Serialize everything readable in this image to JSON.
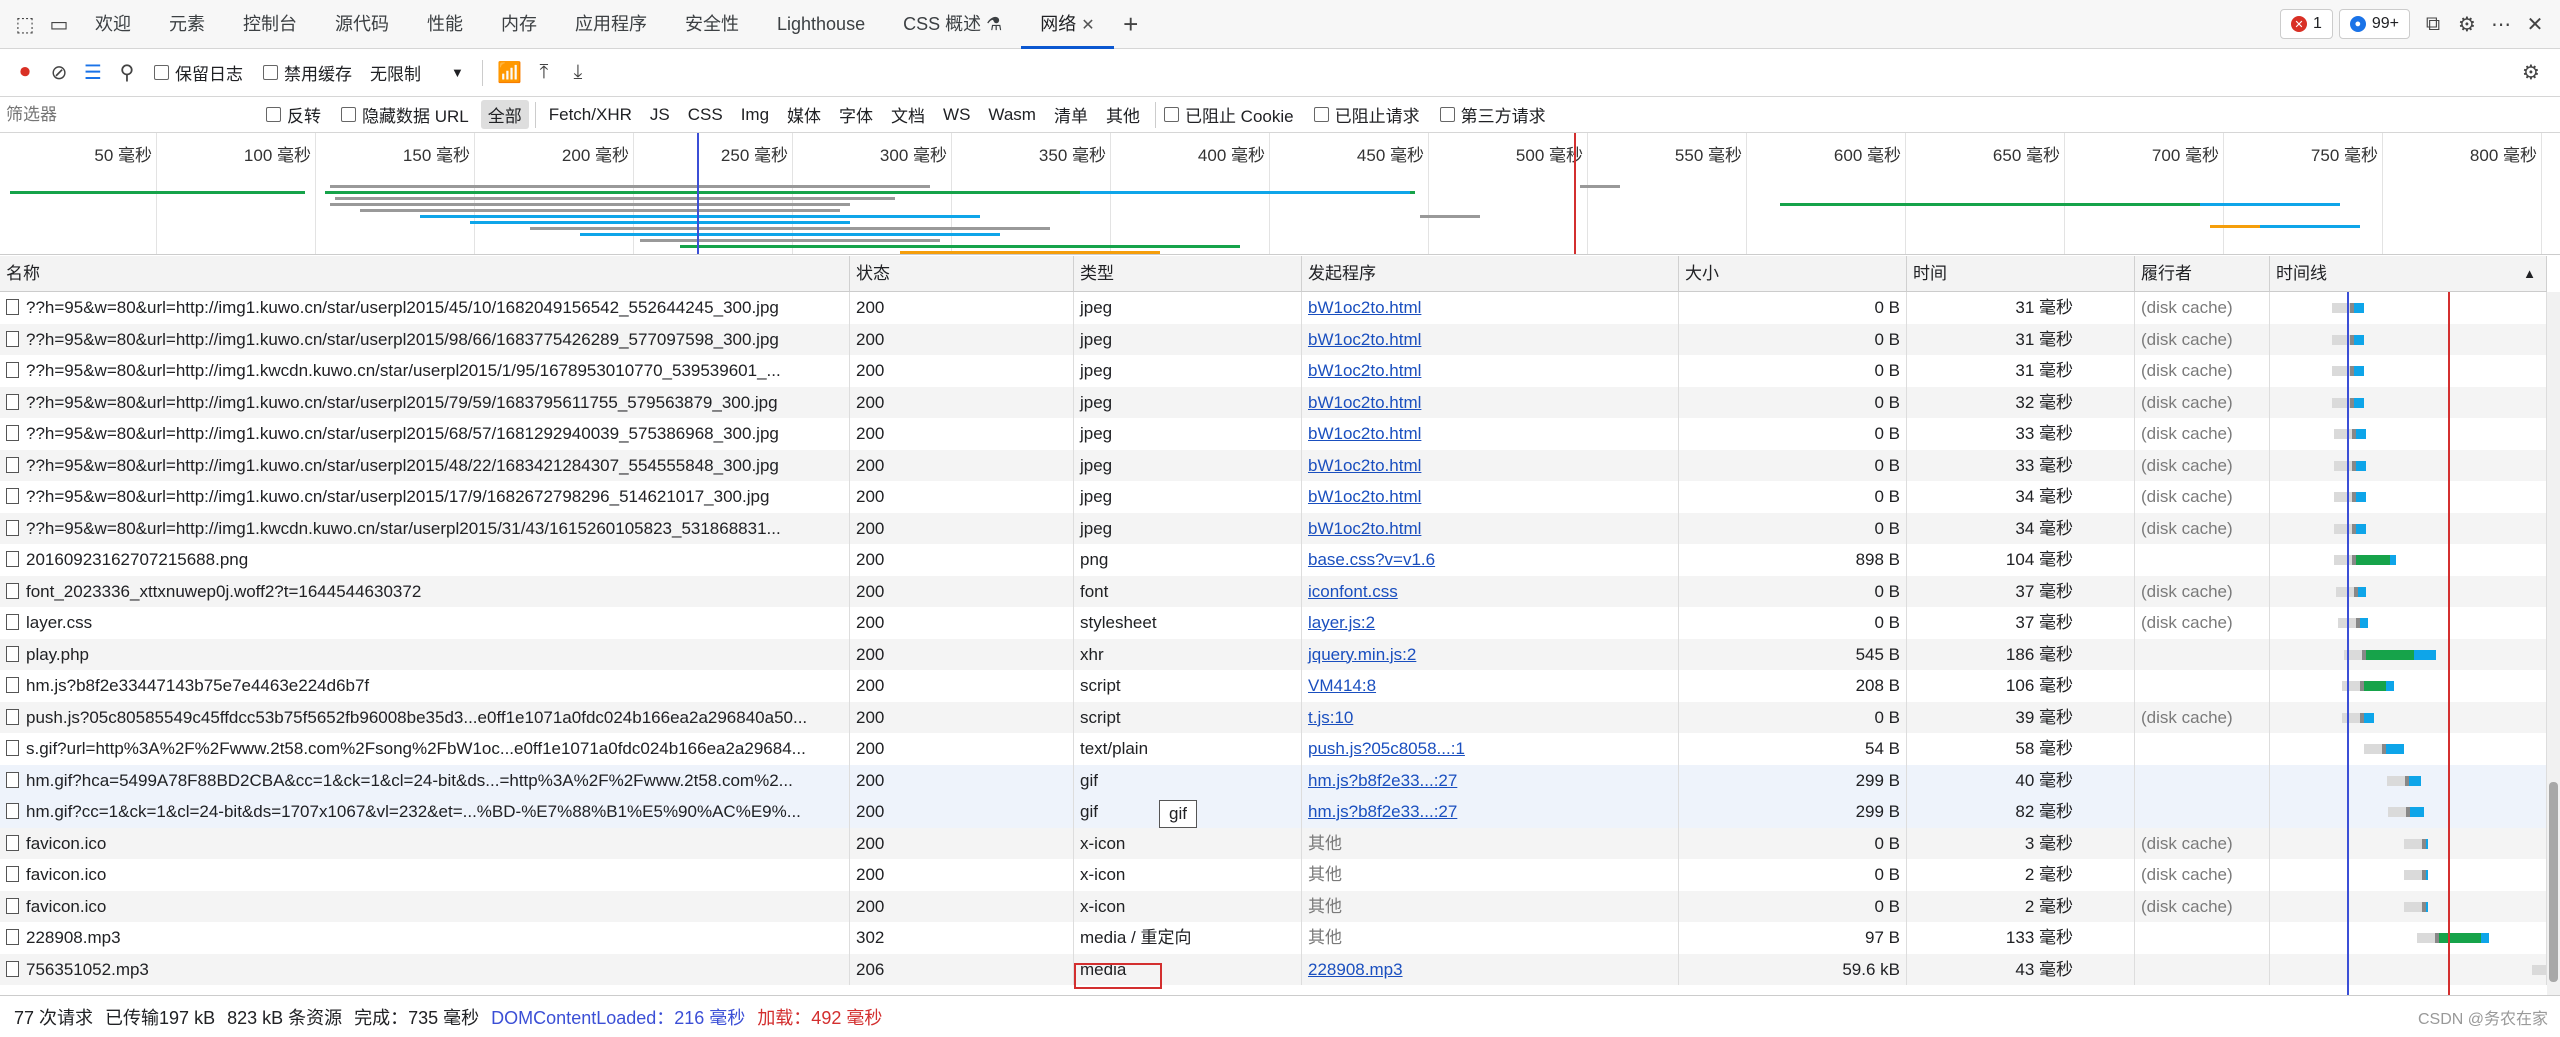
{
  "tabs": [
    {
      "label": "欢迎"
    },
    {
      "label": "元素"
    },
    {
      "label": "控制台"
    },
    {
      "label": "源代码"
    },
    {
      "label": "性能"
    },
    {
      "label": "内存"
    },
    {
      "label": "应用程序"
    },
    {
      "label": "安全性"
    },
    {
      "label": "Lighthouse"
    },
    {
      "label": "CSS 概述"
    },
    {
      "label": "网络"
    }
  ],
  "badges": {
    "errors": "1",
    "messages": "99+"
  },
  "toolbar": {
    "preserve_log": "保留日志",
    "disable_cache": "禁用缓存",
    "throttle": "无限制"
  },
  "filter": {
    "placeholder": "筛选器",
    "invert": "反转",
    "hide_data_url": "隐藏数据 URL",
    "types": [
      "全部",
      "Fetch/XHR",
      "JS",
      "CSS",
      "Img",
      "媒体",
      "字体",
      "文档",
      "WS",
      "Wasm",
      "清单",
      "其他"
    ],
    "blocked_cookie": "已阻止 Cookie",
    "blocked_requests": "已阻止请求",
    "third_party": "第三方请求"
  },
  "overview": {
    "ticks": [
      "50 毫秒",
      "100 毫秒",
      "150 毫秒",
      "200 毫秒",
      "250 毫秒",
      "300 毫秒",
      "350 毫秒",
      "400 毫秒",
      "450 毫秒",
      "500 毫秒",
      "550 毫秒",
      "600 毫秒",
      "650 毫秒",
      "700 毫秒",
      "750 毫秒",
      "800 毫秒"
    ]
  },
  "columns": {
    "name": "名称",
    "status": "状态",
    "type": "类型",
    "initiator": "发起程序",
    "size": "大小",
    "time": "时间",
    "fulfilled": "履行者",
    "waterfall": "时间线"
  },
  "rows": [
    {
      "name": "??h=95&w=80&url=http://img1.kuwo.cn/star/userpl2015/45/10/1682049156542_552644245_300.jpg",
      "status": "200",
      "type": "jpeg",
      "initiator": "bW1oc2to.html",
      "link": true,
      "size": "0 B",
      "time": "31 毫秒",
      "ful": "(disk cache)"
    },
    {
      "name": "??h=95&w=80&url=http://img1.kuwo.cn/star/userpl2015/98/66/1683775426289_577097598_300.jpg",
      "status": "200",
      "type": "jpeg",
      "initiator": "bW1oc2to.html",
      "link": true,
      "size": "0 B",
      "time": "31 毫秒",
      "ful": "(disk cache)"
    },
    {
      "name": "??h=95&w=80&url=http://img1.kwcdn.kuwo.cn/star/userpl2015/1/95/1678953010770_539539601_...",
      "status": "200",
      "type": "jpeg",
      "initiator": "bW1oc2to.html",
      "link": true,
      "size": "0 B",
      "time": "31 毫秒",
      "ful": "(disk cache)"
    },
    {
      "name": "??h=95&w=80&url=http://img1.kuwo.cn/star/userpl2015/79/59/1683795611755_579563879_300.jpg",
      "status": "200",
      "type": "jpeg",
      "initiator": "bW1oc2to.html",
      "link": true,
      "size": "0 B",
      "time": "32 毫秒",
      "ful": "(disk cache)"
    },
    {
      "name": "??h=95&w=80&url=http://img1.kuwo.cn/star/userpl2015/68/57/1681292940039_575386968_300.jpg",
      "status": "200",
      "type": "jpeg",
      "initiator": "bW1oc2to.html",
      "link": true,
      "size": "0 B",
      "time": "33 毫秒",
      "ful": "(disk cache)"
    },
    {
      "name": "??h=95&w=80&url=http://img1.kuwo.cn/star/userpl2015/48/22/1683421284307_554555848_300.jpg",
      "status": "200",
      "type": "jpeg",
      "initiator": "bW1oc2to.html",
      "link": true,
      "size": "0 B",
      "time": "33 毫秒",
      "ful": "(disk cache)"
    },
    {
      "name": "??h=95&w=80&url=http://img1.kuwo.cn/star/userpl2015/17/9/1682672798296_514621017_300.jpg",
      "status": "200",
      "type": "jpeg",
      "initiator": "bW1oc2to.html",
      "link": true,
      "size": "0 B",
      "time": "34 毫秒",
      "ful": "(disk cache)"
    },
    {
      "name": "??h=95&w=80&url=http://img1.kwcdn.kuwo.cn/star/userpl2015/31/43/1615260105823_531868831...",
      "status": "200",
      "type": "jpeg",
      "initiator": "bW1oc2to.html",
      "link": true,
      "size": "0 B",
      "time": "34 毫秒",
      "ful": "(disk cache)"
    },
    {
      "name": "20160923162707215688.png",
      "status": "200",
      "type": "png",
      "initiator": "base.css?v=v1.6",
      "link": true,
      "size": "898 B",
      "time": "104 毫秒",
      "ful": ""
    },
    {
      "name": "font_2023336_xttxnuwep0j.woff2?t=1644544630372",
      "status": "200",
      "type": "font",
      "initiator": "iconfont.css",
      "link": true,
      "size": "0 B",
      "time": "37 毫秒",
      "ful": "(disk cache)"
    },
    {
      "name": "layer.css",
      "status": "200",
      "type": "stylesheet",
      "initiator": "layer.js:2",
      "link": true,
      "size": "0 B",
      "time": "37 毫秒",
      "ful": "(disk cache)"
    },
    {
      "name": "play.php",
      "status": "200",
      "type": "xhr",
      "initiator": "jquery.min.js:2",
      "link": true,
      "size": "545 B",
      "time": "186 毫秒",
      "ful": ""
    },
    {
      "name": "hm.js?b8f2e33447143b75e7e4463e224d6b7f",
      "status": "200",
      "type": "script",
      "initiator": "VM414:8",
      "link": true,
      "size": "208 B",
      "time": "106 毫秒",
      "ful": ""
    },
    {
      "name": "push.js?05c80585549c45ffdcc53b75f5652fb96008be35d3...e0ff1e1071a0fdc024b166ea2a296840a50...",
      "status": "200",
      "type": "script",
      "initiator": "t.js:10",
      "link": true,
      "size": "0 B",
      "time": "39 毫秒",
      "ful": "(disk cache)"
    },
    {
      "name": "s.gif?url=http%3A%2F%2Fwww.2t58.com%2Fsong%2FbW1oc...e0ff1e1071a0fdc024b166ea2a29684...",
      "status": "200",
      "type": "text/plain",
      "initiator": "push.js?05c8058...:1",
      "link": true,
      "size": "54 B",
      "time": "58 毫秒",
      "ful": ""
    },
    {
      "name": "hm.gif?hca=5499A78F88BD2CBA&cc=1&ck=1&cl=24-bit&ds...=http%3A%2F%2Fwww.2t58.com%2...",
      "status": "200",
      "type": "gif",
      "initiator": "hm.js?b8f2e33...:27",
      "link": true,
      "size": "299 B",
      "time": "40 毫秒",
      "ful": ""
    },
    {
      "name": "hm.gif?cc=1&ck=1&cl=24-bit&ds=1707x1067&vl=232&et=...%BD-%E7%88%B1%E5%90%AC%E9%...",
      "status": "200",
      "type": "gif",
      "initiator": "hm.js?b8f2e33...:27",
      "link": true,
      "size": "299 B",
      "time": "82 毫秒",
      "ful": ""
    },
    {
      "name": "favicon.ico",
      "status": "200",
      "type": "x-icon",
      "initiator": "其他",
      "link": false,
      "size": "0 B",
      "time": "3 毫秒",
      "ful": "(disk cache)"
    },
    {
      "name": "favicon.ico",
      "status": "200",
      "type": "x-icon",
      "initiator": "其他",
      "link": false,
      "size": "0 B",
      "time": "2 毫秒",
      "ful": "(disk cache)"
    },
    {
      "name": "favicon.ico",
      "status": "200",
      "type": "x-icon",
      "initiator": "其他",
      "link": false,
      "size": "0 B",
      "time": "2 毫秒",
      "ful": "(disk cache)"
    },
    {
      "name": "228908.mp3",
      "status": "302",
      "type": "media / 重定向",
      "initiator": "其他",
      "link": false,
      "size": "97 B",
      "time": "133 毫秒",
      "ful": ""
    },
    {
      "name": "756351052.mp3",
      "status": "206",
      "type": "media",
      "initiator": "228908.mp3",
      "link": true,
      "size": "59.6 kB",
      "time": "43 毫秒",
      "ful": ""
    }
  ],
  "tooltip": "gif",
  "status_bar": {
    "requests": "77 次请求",
    "transferred": "已传输197 kB",
    "resources": "823 kB 条资源",
    "finish": "完成：735  毫秒",
    "dcl": "DOMContentLoaded：216  毫秒",
    "load": "加载：492  毫秒"
  },
  "watermark": "CSDN @务农在家",
  "colors": {
    "accent": "#0b57d0",
    "link": "#1a4fbf",
    "waiting": "#0ea5e9",
    "download": "#16a34a",
    "load_line": "#d32f2f",
    "dcl_line": "#3b4fd6"
  }
}
